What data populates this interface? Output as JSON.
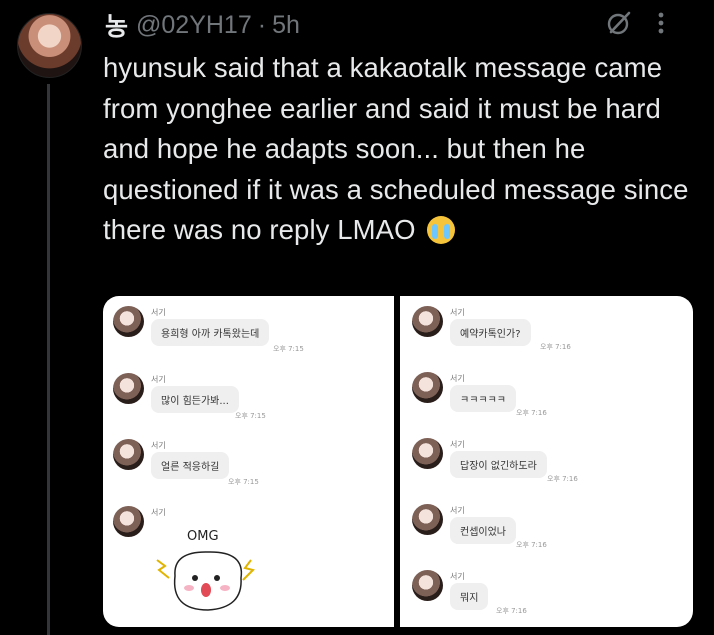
{
  "tweet": {
    "display_name": "농",
    "handle": "@02YH17",
    "separator": "·",
    "time": "5h",
    "text": "hyunsuk said that a kakaotalk message came from yonghee earlier and said it must be hard and hope he adapts soon... but then he questioned if it was a scheduled message since there was no reply LMAO",
    "emoji": "loudly-crying-face-emoji"
  },
  "icons": [
    "grok-icon",
    "more-options-icon"
  ],
  "chat_left": {
    "messages": [
      {
        "sender": "서기",
        "text": "용희형 아까 카톡왔는데",
        "time": "오후 7:15"
      },
      {
        "sender": "서기",
        "text": "많이 힘든가봐...",
        "time": "오후 7:15"
      },
      {
        "sender": "서기",
        "text": "얼른 적응하길",
        "time": "오후 7:15"
      }
    ],
    "sticker": {
      "sender": "서기",
      "text": "OMG"
    }
  },
  "chat_right": {
    "messages": [
      {
        "sender": "서기",
        "text": "예약카톡인가?",
        "time": "오후 7:16"
      },
      {
        "sender": "서기",
        "text": "ㅋㅋㅋㅋㅋ",
        "time": "오후 7:16"
      },
      {
        "sender": "서기",
        "text": "답장이 없긴하도라",
        "time": "오후 7:16"
      },
      {
        "sender": "서기",
        "text": "컨셉이었나",
        "time": "오후 7:16"
      },
      {
        "sender": "서기",
        "text": "뭐지",
        "time": "오후 7:16"
      }
    ]
  }
}
